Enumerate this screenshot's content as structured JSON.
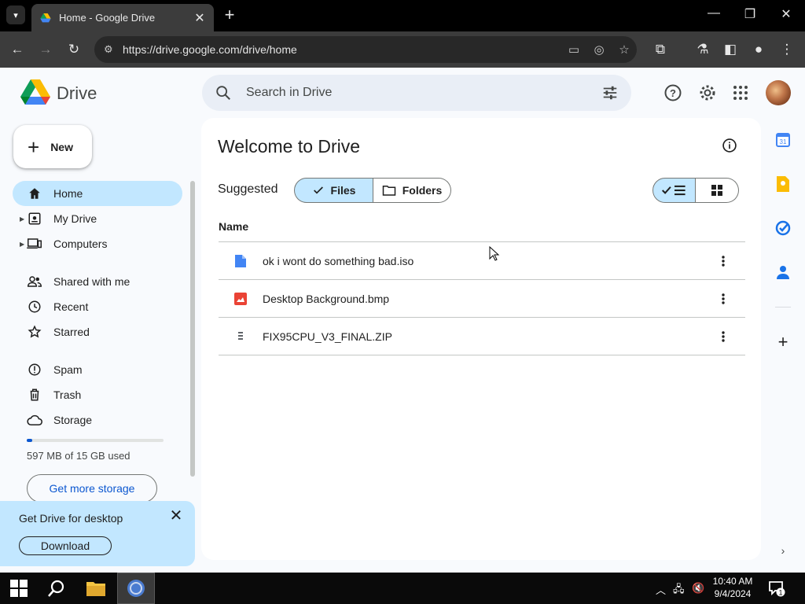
{
  "browser": {
    "tab_title": "Home - Google Drive",
    "url": "https://drive.google.com/drive/home"
  },
  "app": {
    "brand": "Drive",
    "search_placeholder": "Search in Drive",
    "new_label": "New"
  },
  "sidebar": {
    "items": [
      {
        "label": "Home",
        "icon": "home-icon"
      },
      {
        "label": "My Drive",
        "icon": "my-drive-icon"
      },
      {
        "label": "Computers",
        "icon": "computers-icon"
      },
      {
        "label": "Shared with me",
        "icon": "shared-icon"
      },
      {
        "label": "Recent",
        "icon": "clock-icon"
      },
      {
        "label": "Starred",
        "icon": "star-icon"
      },
      {
        "label": "Spam",
        "icon": "spam-icon"
      },
      {
        "label": "Trash",
        "icon": "trash-icon"
      },
      {
        "label": "Storage",
        "icon": "cloud-icon"
      }
    ],
    "storage_used_fraction": 0.039,
    "storage_text": "597 MB of 15 GB used",
    "get_more_storage": "Get more storage"
  },
  "promo": {
    "title": "Get Drive for desktop",
    "download": "Download"
  },
  "main": {
    "title": "Welcome to Drive",
    "suggested": "Suggested",
    "chip_files": "Files",
    "chip_folders": "Folders",
    "col_name": "Name",
    "files": [
      {
        "name": "ok i wont do something bad.iso",
        "icon": "doc-icon"
      },
      {
        "name": "Desktop Background.bmp",
        "icon": "image-icon"
      },
      {
        "name": "FIX95CPU_V3_FINAL.ZIP",
        "icon": "zip-icon"
      }
    ]
  },
  "taskbar": {
    "time": "10:40 AM",
    "date": "9/4/2024",
    "notifications": "1"
  },
  "colors": {
    "accent": "#0b57d0",
    "selected": "#c2e7ff"
  }
}
